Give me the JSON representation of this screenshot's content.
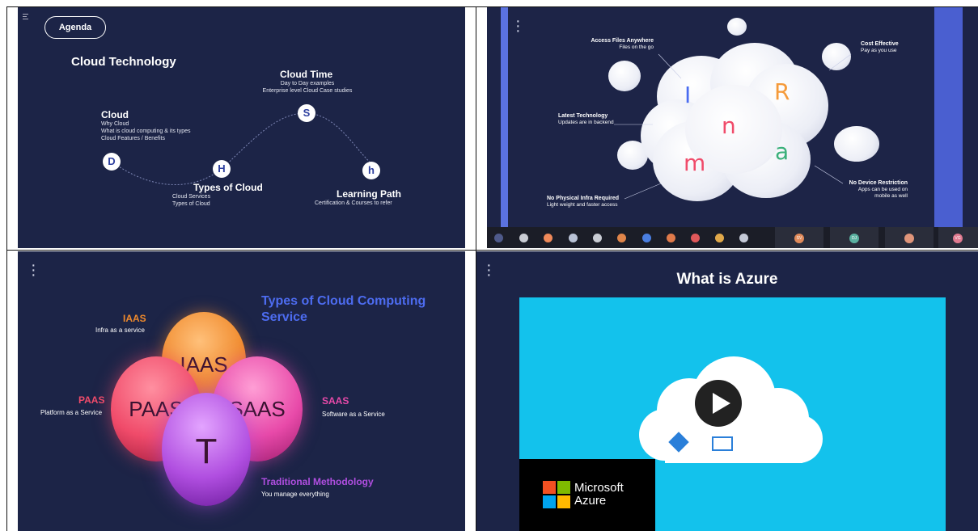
{
  "panel1": {
    "agenda_button": "Agenda",
    "title": "Cloud Technology",
    "nodes": {
      "d": "D",
      "h": "H",
      "s": "S",
      "hh": "h"
    },
    "cloud": {
      "heading": "Cloud",
      "lines": [
        "Why Cloud",
        "What is cloud computing & its types",
        "Cloud Features / Benefits"
      ]
    },
    "cloud_time": {
      "heading": "Cloud Time",
      "lines": [
        "Day to Day examples",
        "Enterprise level Cloud Case studies"
      ]
    },
    "types": {
      "heading": "Types of Cloud",
      "lines": [
        "Cloud Services",
        "Types of Cloud"
      ]
    },
    "learning": {
      "heading": "Learning Path",
      "lines": [
        "Certification & Courses to refer"
      ]
    }
  },
  "panel2": {
    "letters": {
      "i": "I",
      "r": "R",
      "n": "n",
      "a": "a",
      "m": "m"
    },
    "labels": {
      "access": {
        "title": "Access Files Anywhere",
        "sub": "Files on the go"
      },
      "cost": {
        "title": "Cost Effective",
        "sub": "Pay as you use"
      },
      "latest": {
        "title": "Latest Technology",
        "sub": "Updates are in backend"
      },
      "device": {
        "title": "No Device Restriction",
        "sub": "Apps can be used on mobile as well"
      },
      "infra": {
        "title": "No Physical Infra Required",
        "sub": "Light weight and faster access"
      }
    },
    "taskbar_tiles": [
      "SV",
      "DJ",
      "",
      "VG"
    ]
  },
  "panel3": {
    "title_line1": "Types of Cloud Computing",
    "title_line2": "Service",
    "iaas": {
      "label": "IAAS",
      "sub": "Infra as a service",
      "sphere": "IAAS"
    },
    "paas": {
      "label": "PAAS",
      "sub": "Platform as a Service",
      "sphere": "PAAS"
    },
    "saas": {
      "label": "SAAS",
      "sub": "Software as a Service",
      "sphere": "SAAS"
    },
    "trad": {
      "label": "Traditional Methodology",
      "sub": "You manage everything",
      "sphere": "T"
    },
    "colors": {
      "iaas": "#f08a2c",
      "paas": "#f04b6a",
      "saas": "#e84aa9",
      "trad": "#b04ee0"
    }
  },
  "panel4": {
    "title": "What is Azure",
    "logo_line1": "Microsoft",
    "logo_line2": "Azure"
  }
}
